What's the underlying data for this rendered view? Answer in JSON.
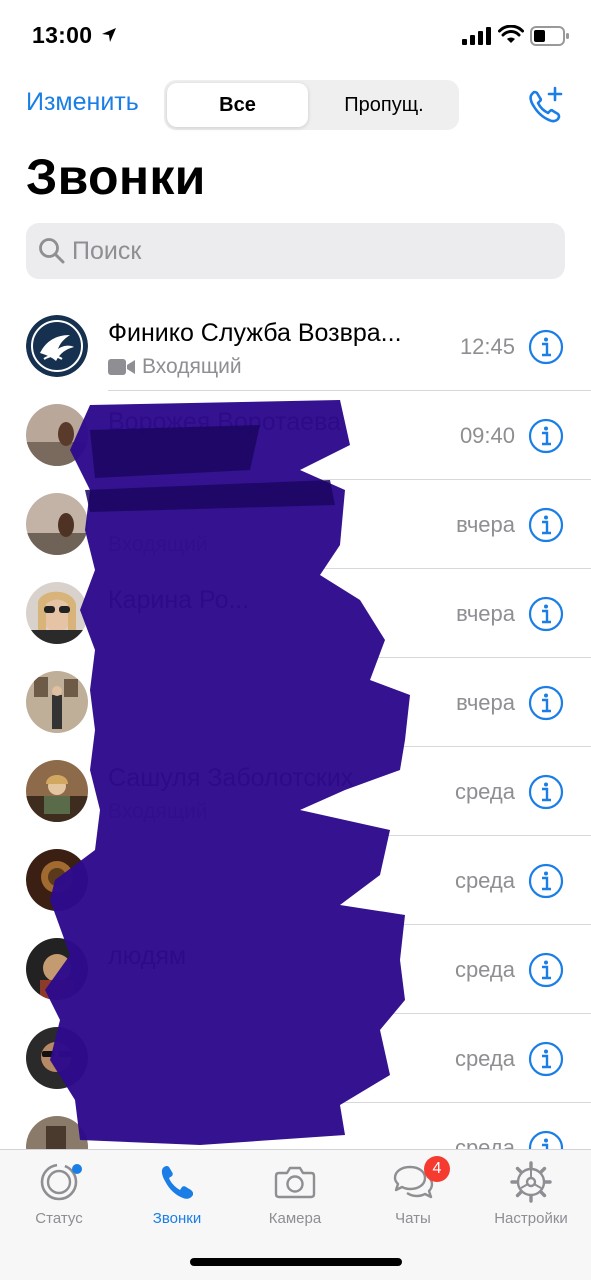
{
  "status_bar": {
    "time": "13:00",
    "icons": [
      "location-arrow-icon",
      "cellular-signal-icon",
      "wifi-icon",
      "battery-icon"
    ]
  },
  "header": {
    "edit_label": "Изменить",
    "segments": [
      {
        "label": "Все",
        "selected": true
      },
      {
        "label": "Пропущ.",
        "selected": false
      }
    ],
    "new_call_icon": "phone-plus-icon",
    "title": "Звонки"
  },
  "search": {
    "placeholder": "Поиск",
    "value": ""
  },
  "calls": [
    {
      "name": "Финико Служба Возвра...",
      "type": "Входящий",
      "time": "12:45",
      "video": true
    },
    {
      "name": "Ворожея Воротаева",
      "type": "",
      "time": "09:40",
      "video": false
    },
    {
      "name": "",
      "type": "Входящий",
      "time": "вчера",
      "video": false
    },
    {
      "name": "Карина Ро...",
      "type": "",
      "time": "вчера",
      "video": false
    },
    {
      "name": "",
      "type": "",
      "time": "вчера",
      "video": false
    },
    {
      "name": "Сашуля Заболотских",
      "type": "Входящий",
      "time": "среда",
      "video": false
    },
    {
      "name": "",
      "type": "",
      "time": "среда",
      "video": false
    },
    {
      "name": "людям",
      "type": "",
      "time": "среда",
      "video": false
    },
    {
      "name": "",
      "type": "",
      "time": "среда",
      "video": false
    },
    {
      "name": "",
      "type": "",
      "time": "среда",
      "video": false
    }
  ],
  "tabs": [
    {
      "label": "Статус",
      "icon": "status-ring-icon",
      "active": false
    },
    {
      "label": "Звонки",
      "icon": "phone-icon",
      "active": true
    },
    {
      "label": "Камера",
      "icon": "camera-icon",
      "active": false
    },
    {
      "label": "Чаты",
      "icon": "chat-bubbles-icon",
      "active": false,
      "badge": "4"
    },
    {
      "label": "Настройки",
      "icon": "gear-icon",
      "active": false
    }
  ],
  "colors": {
    "accent": "#1a7ee6",
    "badge": "#f53b30",
    "scribble": "#2d0a8c",
    "secondary_text": "#8e8e93"
  }
}
